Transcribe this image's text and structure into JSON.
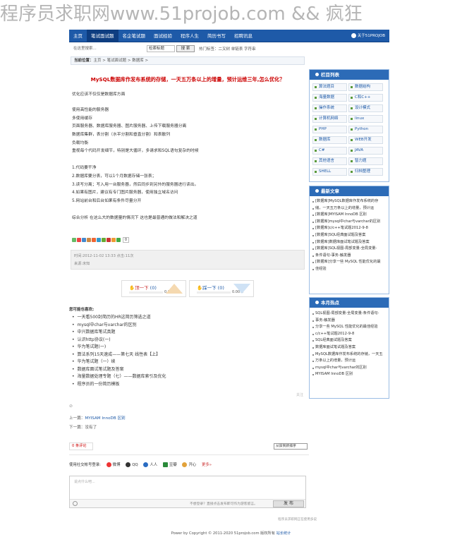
{
  "watermark": "程序员求职网www.51projob.com  && 疯狂",
  "logo": {
    "title": "程序员",
    "sub": "www.51projob.com"
  },
  "nav": {
    "items": [
      "主页",
      "笔试面试题",
      "名企笔试题",
      "面试经验",
      "程序人生",
      "简历书写",
      "招聘讯息"
    ],
    "active": 1,
    "about": "关于51PROJOB"
  },
  "search": {
    "placeholder": "在这里搜索...",
    "select": "检索标题",
    "button": "搜 索",
    "hot": "热门标签：二叉树  单链表  字符串"
  },
  "breadcrumb": {
    "label": "当前位置：",
    "path": "主页 > 笔试面试题 > 数据库 >"
  },
  "article": {
    "title": "MySQL数据库作发布系统的存储，一天五万条以上的增量，预计运维三年,怎么优化？",
    "lines": [
      "优化应该不仅仅是数据库方面",
      "",
      "使用高性能的服务器",
      "多使用缓存",
      "页面服务器、数据库服务器、图片服务器、上传下载服务器分离",
      "数据库集群，表分割（水平分割和垂直分割）和表散列",
      "负载均衡",
      "重视每个代码开发细节，特别是大循环，多请求和SQL语句复杂的时候",
      "",
      "1.代码要干净",
      "2.数据库要分表，可以1个月数据存储一张表；",
      "3.读写分离；写入用一台服务器，然后同步到另外的服务器进行读出。",
      "4.如果有图片，建议有专门图片服务器，使用独立域名访问",
      "5.网站前台和后台如果有条件尽量分开",
      "",
      "综合分析 在这么大的数据量的情况下 这也是最普通的做法和解决之道"
    ],
    "share_count": "0",
    "time": "时间:2012-11-02 13:33    点击:11次",
    "source": "来源:未知"
  },
  "vote": {
    "up": {
      "label": "顶一下",
      "count": "(0)",
      "pct": "0.00%"
    },
    "down": {
      "label": "踩一下",
      "count": "(0)",
      "pct": "0.00%"
    }
  },
  "related": {
    "heading": "您可能也喜欢:",
    "items": [
      "一天看500封简历的HR这简历筛选之道",
      "mysql中char与varchar的区别",
      "中兴数据库笔试真题",
      "认识http协议(一)",
      "华为笔试题(一)",
      "算法系列15天速成——第七天 线性表【上】",
      "华为笔试题（一）续",
      "数据库面试笔试题及答案",
      "海量数据处理专题（七）——数据库索引及优化",
      "程序员的一份简历模板"
    ],
    "watch": "关注"
  },
  "nav_prev": {
    "prev_label": "上一篇：",
    "prev_link": "MYISAM InnoDB 区别",
    "next_label": "下一篇：",
    "next_text": "没有了"
  },
  "comments": {
    "count_label": "0 条评论",
    "sort": "从旧到新排序",
    "login_label": "使用社交帐号登录:",
    "services": [
      "微博",
      "QQ",
      "人人",
      "豆瓣",
      "开心"
    ],
    "more": "更多»",
    "placeholder": "说点什么吧...",
    "tip": "不想登录？直接点击发布即可作为游客留言。",
    "send": "发 布",
    "footer": "程序员求职网正在使用多说"
  },
  "copyright": {
    "text": "Power by Copyright © 2011-2020 51projob.com 版权所有",
    "link": "站长统计"
  },
  "sidebar": {
    "columns_title": "栏目列表",
    "columns": [
      "算法题目",
      "数据结构",
      "海量数据",
      "C和C++",
      "操作系统",
      "设计模式",
      "计算机网络",
      "linux",
      "PHP",
      "Python",
      "数据库",
      "WEB开发",
      "C#",
      "JAVA",
      "其他语言",
      "智力题",
      "SHELL",
      "归档整理"
    ],
    "latest_title": "最新文章",
    "latest": [
      "[数据库]MySQL数据库作发布系统的存",
      "储，一天五万条以上的增量，预计运",
      "[数据库]MYISAM InnoDB 区别",
      "[数据库]mysql中char与varchar的区别",
      "[数据库]c/c++笔试题2012-9-8",
      "[数据库]SQL经典面试题及答案",
      "[数据库]数据库面试笔试题及答案",
      "[数据库]SQL视图-局部变量-全局变量-",
      "条件语句-事务-触发器",
      "[数据库]分享一些 MySQL 性能优化的最",
      "佳经验"
    ],
    "hot_title": "本月热点",
    "hot": [
      "SQL视图-局部变量-全局变量-条件语句-",
      "事务-触发器",
      "分享一些 MySQL 性能优化的最佳经验",
      "c/c++笔试题2012-9-8",
      "SQL经典面试题及答案",
      "数据库面试笔试题及答案",
      "MySQL数据库作发布系统的存储，一天五",
      "万条以上的增量，预计运",
      "mysql中char与varchar的区别",
      "MYISAM InnoDB 区别"
    ]
  },
  "colors": {
    "nav": "#1e5aa8",
    "title": "#cc0000",
    "sidebar_head": "#2c6bb7"
  }
}
